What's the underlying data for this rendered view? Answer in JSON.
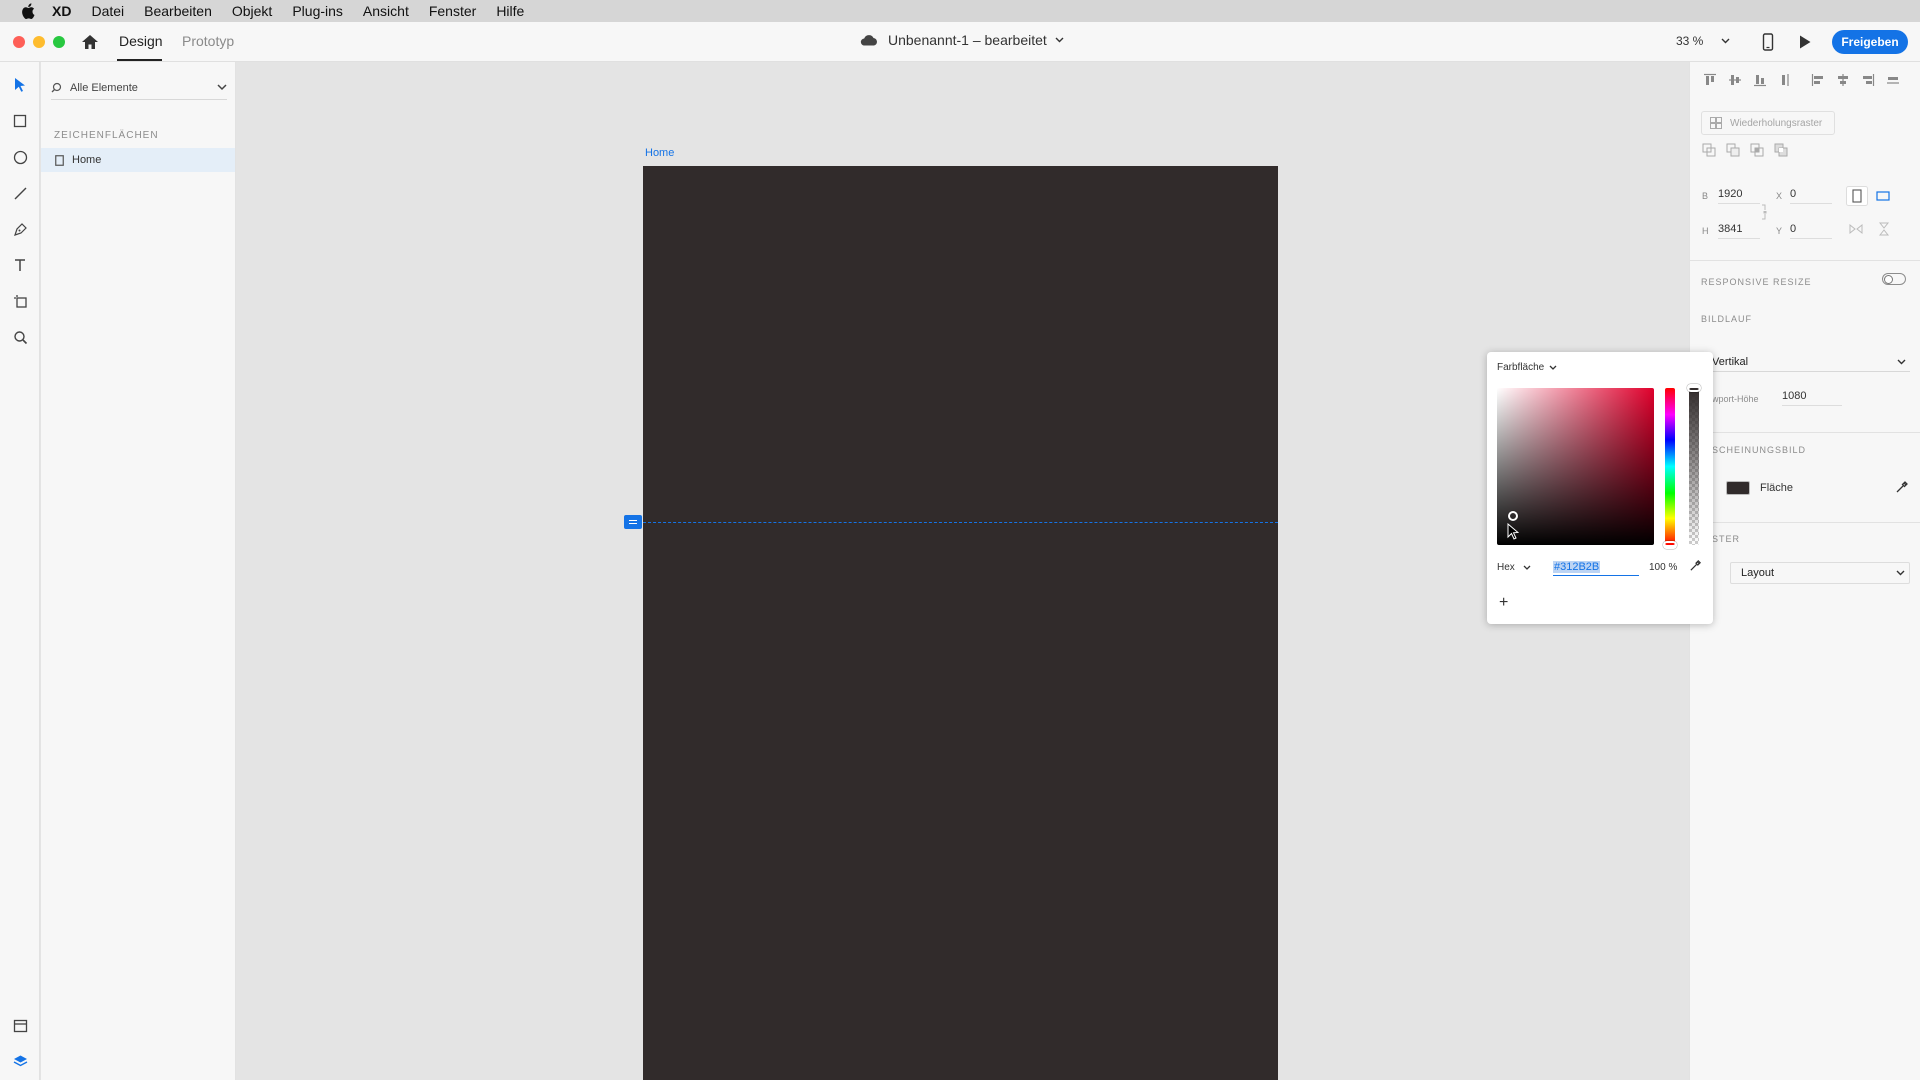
{
  "menubar": {
    "app": "XD",
    "items": [
      "Datei",
      "Bearbeiten",
      "Objekt",
      "Plug-ins",
      "Ansicht",
      "Fenster",
      "Hilfe"
    ]
  },
  "header": {
    "tabs": [
      "Design",
      "Prototyp"
    ],
    "doc_title": "Unbenannt-1 – bearbeitet",
    "zoom": "33 %",
    "share_label": "Freigeben"
  },
  "layers": {
    "search_placeholder": "Alle Elemente",
    "section": "ZEICHENFLÄCHEN",
    "artboards": [
      "Home"
    ]
  },
  "canvas": {
    "artboard_name": "Home",
    "artboard_color": "#312B2B"
  },
  "properties": {
    "repeat_grid": "Wiederholungsraster",
    "w_label": "B",
    "w": "1920",
    "h_label": "H",
    "h": "3841",
    "x_label": "X",
    "x": "0",
    "y_label": "Y",
    "y": "0",
    "responsive_resize": "RESPONSIVE RESIZE",
    "scrolling": "BILDLAUF",
    "scroll_value": "Vertikal",
    "viewport_label": "wport-Höhe",
    "viewport_height": "1080",
    "appearance": "SCHEINUNGSBILD",
    "fill_label": "Fläche",
    "grid_section": "STER",
    "grid_value": "Layout"
  },
  "color_picker": {
    "mode": "Farbfläche",
    "format": "Hex",
    "hex": "#312B2B",
    "opacity": "100 %",
    "add": "+"
  },
  "colors": {
    "accent": "#1473e6",
    "artboard": "#312b2b"
  }
}
